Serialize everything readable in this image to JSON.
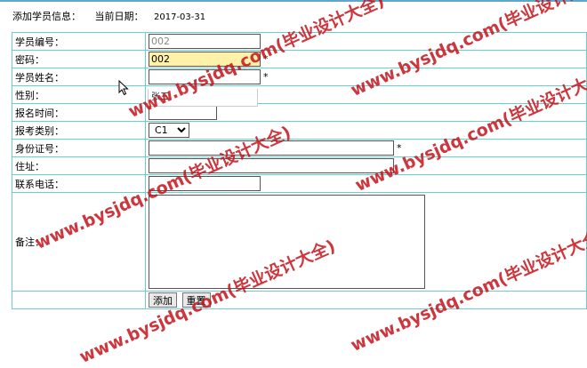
{
  "header": {
    "title_label": "添加学员信息：",
    "date_label": "当前日期：",
    "date_value": "2017-03-31"
  },
  "form": {
    "fields": {
      "student_no": {
        "label": "学员编号：",
        "value": "002"
      },
      "password": {
        "label": "密码：",
        "value": "002",
        "required_mark": "*"
      },
      "name": {
        "label": "学员姓名：",
        "value": "",
        "required_mark": "*"
      },
      "gender": {
        "label": "性别："
      },
      "enroll_time": {
        "label": "报名时间：",
        "value": ""
      },
      "exam_type": {
        "label": "报考类别：",
        "selected": "C1"
      },
      "id_number": {
        "label": "身份证号：",
        "value": "",
        "required_mark": "*"
      },
      "address": {
        "label": "住址：",
        "value": ""
      },
      "phone": {
        "label": "联系电话：",
        "value": ""
      },
      "remarks": {
        "label": "备注：",
        "value": ""
      }
    },
    "autocomplete_suggestion": "张三",
    "buttons": {
      "add": "添加",
      "reset": "重置"
    }
  },
  "watermark": {
    "text": "www.bysjdq.com(毕业设计大全)",
    "color": "#c5141c"
  },
  "icons": {
    "cursor": "mouse-pointer-icon",
    "select_arrow": "triangle-down-icon"
  }
}
